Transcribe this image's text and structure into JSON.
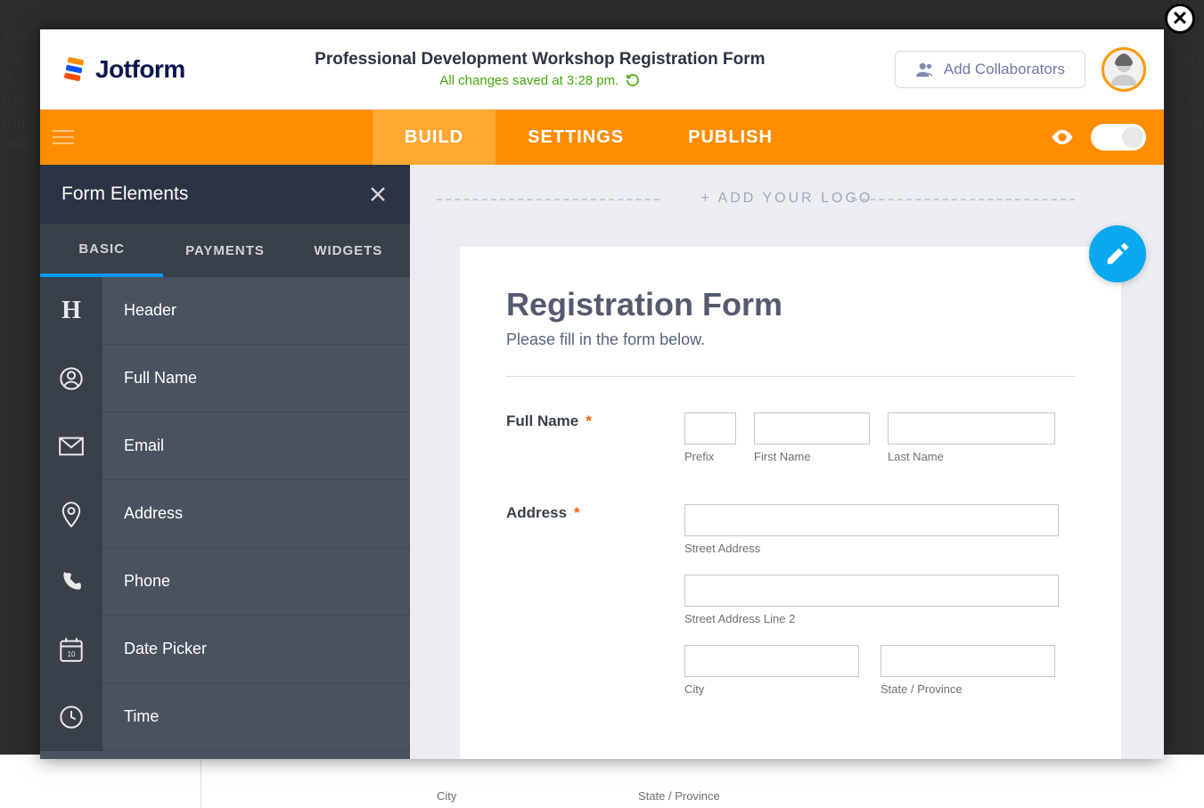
{
  "brand": "Jotform",
  "header": {
    "form_title": "Professional Development Workshop Registration Form",
    "save_status": "All changes saved at 3:28 pm.",
    "collab_label": "Add Collaborators"
  },
  "nav": {
    "tabs": [
      "BUILD",
      "SETTINGS",
      "PUBLISH"
    ],
    "active": 0
  },
  "sidebar": {
    "title": "Form Elements",
    "tabs": [
      "BASIC",
      "PAYMENTS",
      "WIDGETS"
    ],
    "active_tab": 0,
    "elements": [
      {
        "label": "Header",
        "icon": "header"
      },
      {
        "label": "Full Name",
        "icon": "user"
      },
      {
        "label": "Email",
        "icon": "mail"
      },
      {
        "label": "Address",
        "icon": "pin"
      },
      {
        "label": "Phone",
        "icon": "phone"
      },
      {
        "label": "Date Picker",
        "icon": "calendar"
      },
      {
        "label": "Time",
        "icon": "clock"
      }
    ]
  },
  "canvas": {
    "add_logo_label": "+ ADD YOUR LOGO",
    "form_heading": "Registration Form",
    "form_subheading": "Please fill in the form below.",
    "fields": {
      "full_name": {
        "label": "Full Name",
        "sub": {
          "prefix": "Prefix",
          "first": "First Name",
          "last": "Last Name"
        }
      },
      "address": {
        "label": "Address",
        "sub": {
          "street1": "Street Address",
          "street2": "Street Address Line 2",
          "city": "City",
          "state": "State / Province"
        }
      }
    }
  },
  "bg": {
    "bottom_city": "City",
    "bottom_state": "State / Province"
  }
}
